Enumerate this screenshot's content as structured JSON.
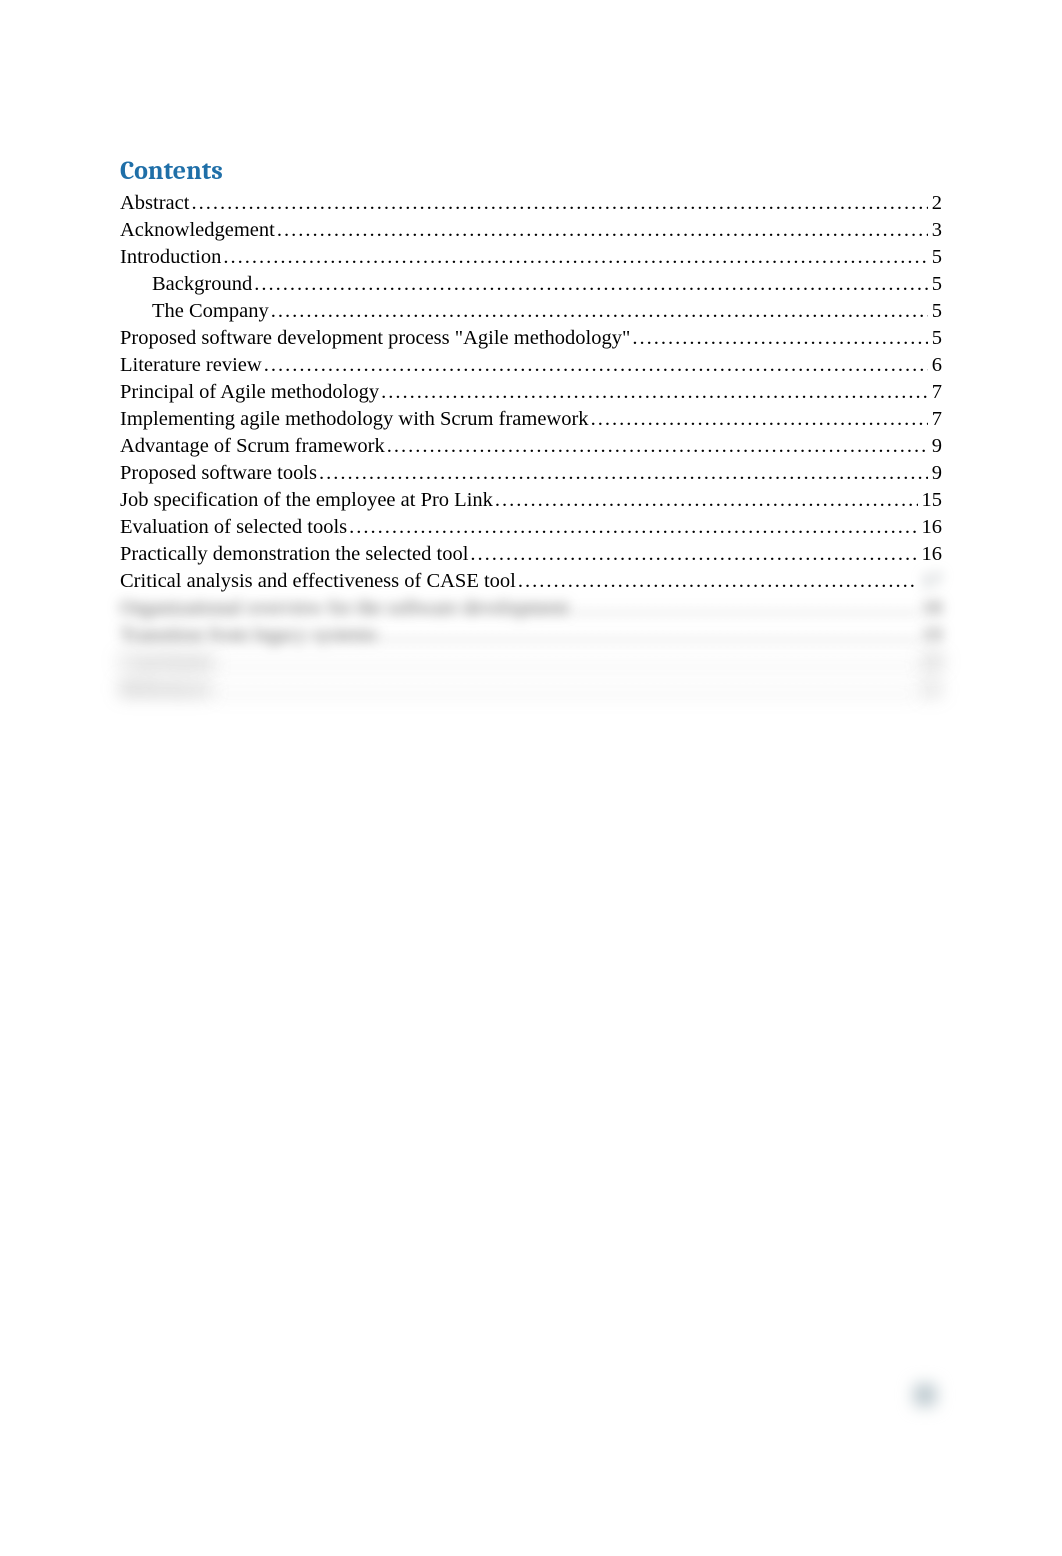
{
  "heading": "Contents",
  "toc": [
    {
      "title": "Abstract",
      "page": "2",
      "indent": 0,
      "blur": "none"
    },
    {
      "title": "Acknowledgement",
      "page": "3",
      "indent": 0,
      "blur": "none"
    },
    {
      "title": "Introduction",
      "page": "5",
      "indent": 0,
      "blur": "none"
    },
    {
      "title": "Background",
      "page": "5",
      "indent": 1,
      "blur": "none"
    },
    {
      "title": "The Company",
      "page": "5",
      "indent": 1,
      "blur": "none"
    },
    {
      "title": "Proposed software development process \"Agile methodology\"",
      "page": "5",
      "indent": 0,
      "blur": "none"
    },
    {
      "title": "Literature review",
      "page": "6",
      "indent": 0,
      "blur": "none"
    },
    {
      "title": "Principal of Agile methodology",
      "page": "7",
      "indent": 0,
      "blur": "none"
    },
    {
      "title": "Implementing agile methodology with Scrum framework",
      "page": "7",
      "indent": 0,
      "blur": "none"
    },
    {
      "title": "Advantage of Scrum framework",
      "page": "9",
      "indent": 0,
      "blur": "none"
    },
    {
      "title": "Proposed software tools",
      "page": "9",
      "indent": 0,
      "blur": "none"
    },
    {
      "title": "Job specification of the employee at Pro Link",
      "page": "15",
      "indent": 0,
      "blur": "none"
    },
    {
      "title": "Evaluation of selected tools",
      "page": "16",
      "indent": 0,
      "blur": "none"
    },
    {
      "title": "Practically demonstration the selected tool",
      "page": "16",
      "indent": 0,
      "blur": "none"
    },
    {
      "title": "Critical analysis and effectiveness of CASE tool",
      "page": "17",
      "indent": 0,
      "blur": "page"
    },
    {
      "title": "Organizational overview for the software development",
      "page": "18",
      "indent": 0,
      "blur": "full"
    },
    {
      "title": "Transition from legacy systems",
      "page": "19",
      "indent": 0,
      "blur": "full"
    },
    {
      "title": "Conclusion",
      "page": "20",
      "indent": 0,
      "blur": "heavy"
    },
    {
      "title": "References",
      "page": "21",
      "indent": 0,
      "blur": "heavy"
    }
  ]
}
